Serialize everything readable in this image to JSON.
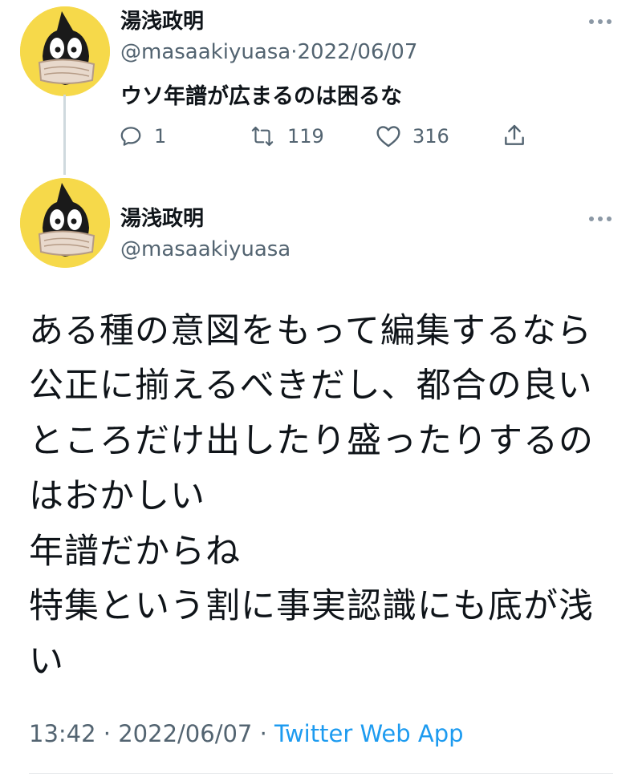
{
  "tweet1": {
    "display_name": "湯浅政明",
    "handle": "@masaakiyuasa",
    "separator": "·",
    "date": "2022/06/07",
    "text": "ウソ年譜が広まるのは困るな",
    "actions": {
      "reply_count": "1",
      "retweet_count": "119",
      "like_count": "316"
    },
    "icons": [
      "reply-icon",
      "retweet-icon",
      "like-icon",
      "share-icon",
      "more-icon"
    ]
  },
  "tweet2": {
    "display_name": "湯浅政明",
    "handle": "@masaakiyuasa",
    "body_lines": [
      "ある種の意図をもって編集するなら",
      "公正に揃えるべきだし、都合の良い",
      "ところだけ出したり盛ったりするの",
      "はおかしい",
      "年譜だからね",
      "特集という割に事実認識にも底が浅",
      "い"
    ],
    "time": "13:42",
    "date": "2022/06/07",
    "separator": "·",
    "source": "Twitter Web App"
  },
  "colors": {
    "text": "#0f1419",
    "secondary": "#536471",
    "link": "#1d9bf0",
    "avatar_bg": "#f6d94a",
    "thread_line": "#cfd9de"
  }
}
